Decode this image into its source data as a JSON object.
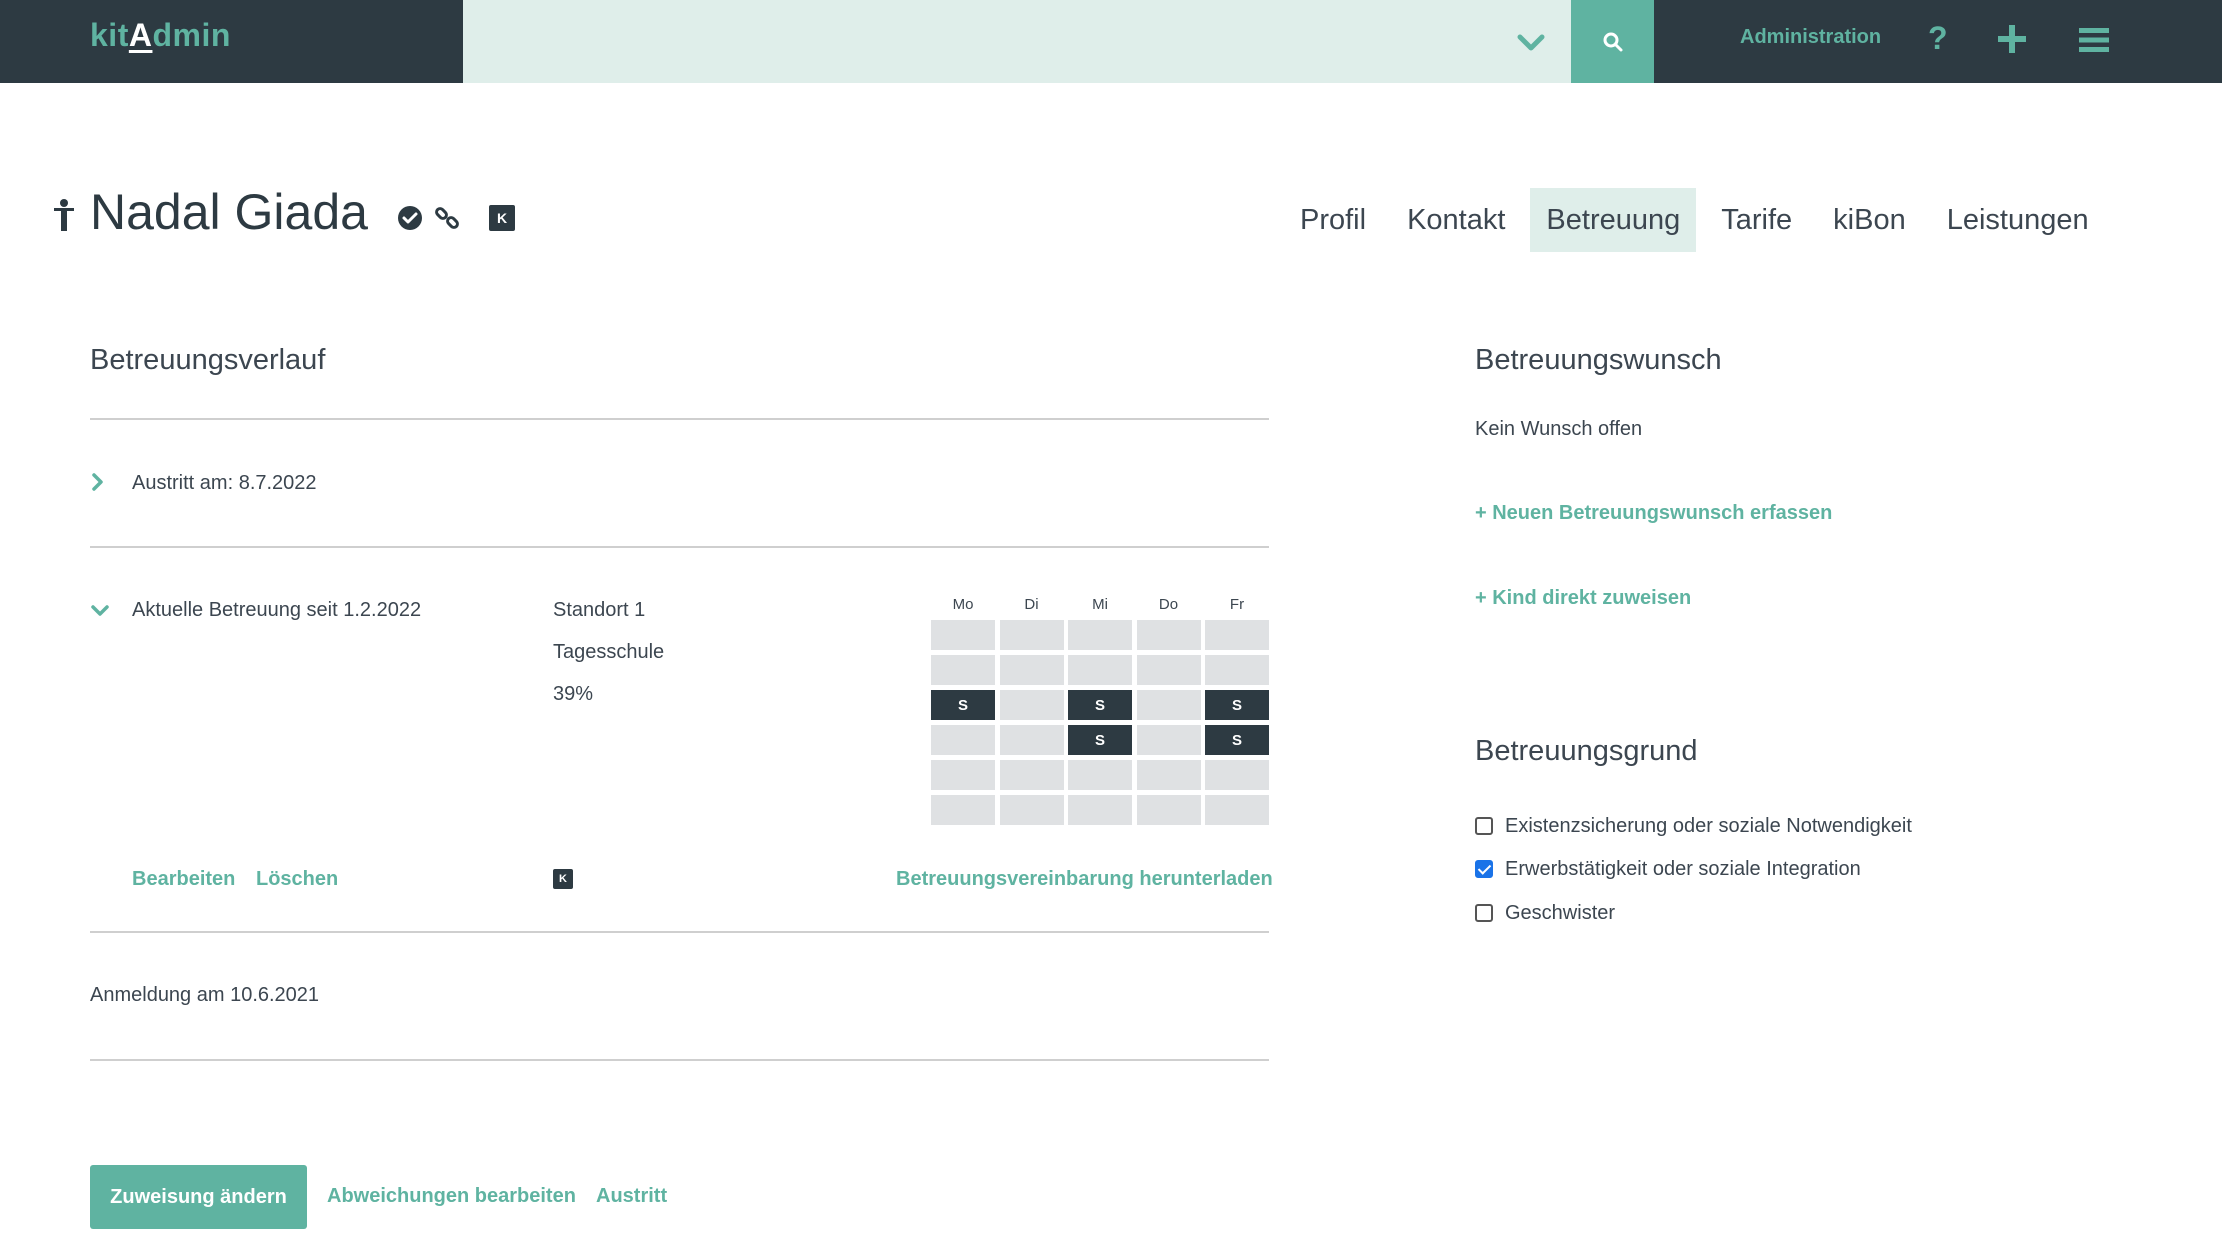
{
  "app": {
    "logo_prefix": "kit",
    "logo_cap": "A",
    "logo_suffix": "dmin",
    "nav_admin": "Administration",
    "nav_help": "?"
  },
  "header": {
    "child_name": "Nadal Giada",
    "k_badge": "K",
    "tabs": [
      {
        "label": "Profil",
        "active": false
      },
      {
        "label": "Kontakt",
        "active": false
      },
      {
        "label": "Betreuung",
        "active": true
      },
      {
        "label": "Tarife",
        "active": false
      },
      {
        "label": "kiBon",
        "active": false
      },
      {
        "label": "Leistungen",
        "active": false
      }
    ]
  },
  "verlauf": {
    "title": "Betreuungsverlauf",
    "austritt": "Austritt am: 8.7.2022",
    "aktuell": "Aktuelle Betreuung seit 1.2.2022",
    "standort": "Standort 1",
    "angebot": "Tagesschule",
    "prozent": "39%",
    "edit": "Bearbeiten",
    "delete": "Löschen",
    "k_badge": "K",
    "download": "Betreuungsvereinbarung herunterladen",
    "anmeldung": "Anmeldung am 10.6.2021",
    "schedule": {
      "days": [
        "Mo",
        "Di",
        "Mi",
        "Do",
        "Fr"
      ],
      "rows": [
        [
          "",
          "",
          "",
          "",
          ""
        ],
        [
          "",
          "",
          "",
          "",
          ""
        ],
        [
          "S",
          "",
          "S",
          "",
          "S"
        ],
        [
          "",
          "",
          "S",
          "",
          "S"
        ],
        [
          "",
          "",
          "",
          "",
          ""
        ],
        [
          "",
          "",
          "",
          "",
          ""
        ]
      ]
    }
  },
  "actions": {
    "primary": "Zuweisung ändern",
    "abweichungen": "Abweichungen bearbeiten",
    "austritt": "Austritt"
  },
  "wunsch": {
    "title": "Betreuungswunsch",
    "empty": "Kein Wunsch offen",
    "new": "+ Neuen Betreuungswunsch erfassen",
    "direct": "+ Kind direkt zuweisen"
  },
  "grund": {
    "title": "Betreuungsgrund",
    "options": [
      {
        "label": "Existenzsicherung oder soziale Notwendigkeit",
        "checked": false
      },
      {
        "label": "Erwerbstätigkeit oder soziale Integration",
        "checked": true
      },
      {
        "label": "Geschwister",
        "checked": false
      }
    ]
  },
  "colors": {
    "accent": "#5fb3a1",
    "dark": "#2d3a42",
    "accent_light": "#dfeeea"
  }
}
